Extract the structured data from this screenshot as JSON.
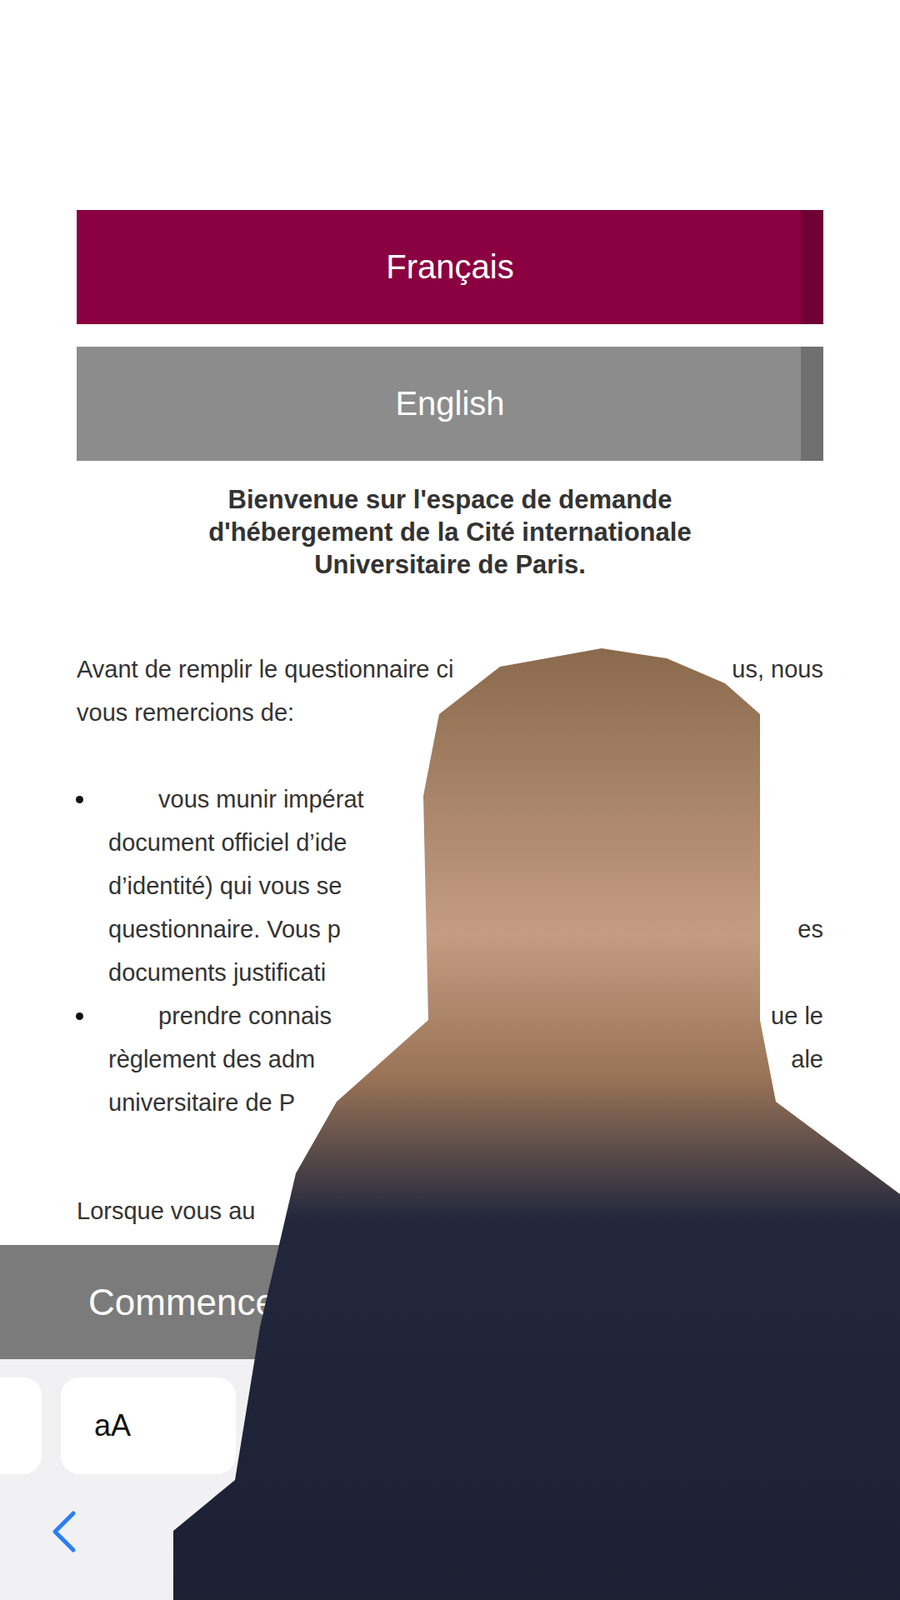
{
  "language_buttons": [
    {
      "label": "Français",
      "selected": true
    },
    {
      "label": "English",
      "selected": false
    }
  ],
  "heading": [
    "Bienvenue sur l'espace de demande",
    "d'hébergement de la Cité internationale",
    "Universitaire de Paris."
  ],
  "intro_lines": [
    {
      "left": "Avant de remplir le questionnaire ci",
      "right": "us, nous"
    },
    {
      "left": "vous remercions de:"
    }
  ],
  "bullets": [
    {
      "lines": [
        {
          "left": "vous munir impérat"
        },
        {
          "left": "document officiel d’ide"
        },
        {
          "left": "d’identité) qui vous se"
        },
        {
          "left": "questionnaire. Vous p",
          "right": "es"
        },
        {
          "left": "documents justificati"
        }
      ]
    },
    {
      "lines": [
        {
          "left": "prendre connais",
          "right": "ue le"
        },
        {
          "left": "règlement des adm",
          "right": "ale"
        },
        {
          "left": "universitaire de P"
        }
      ]
    }
  ],
  "closing_line": "Lorsque vous au",
  "start_button": "Commence",
  "browser_toolbar": {
    "text_size_button": "aA"
  }
}
